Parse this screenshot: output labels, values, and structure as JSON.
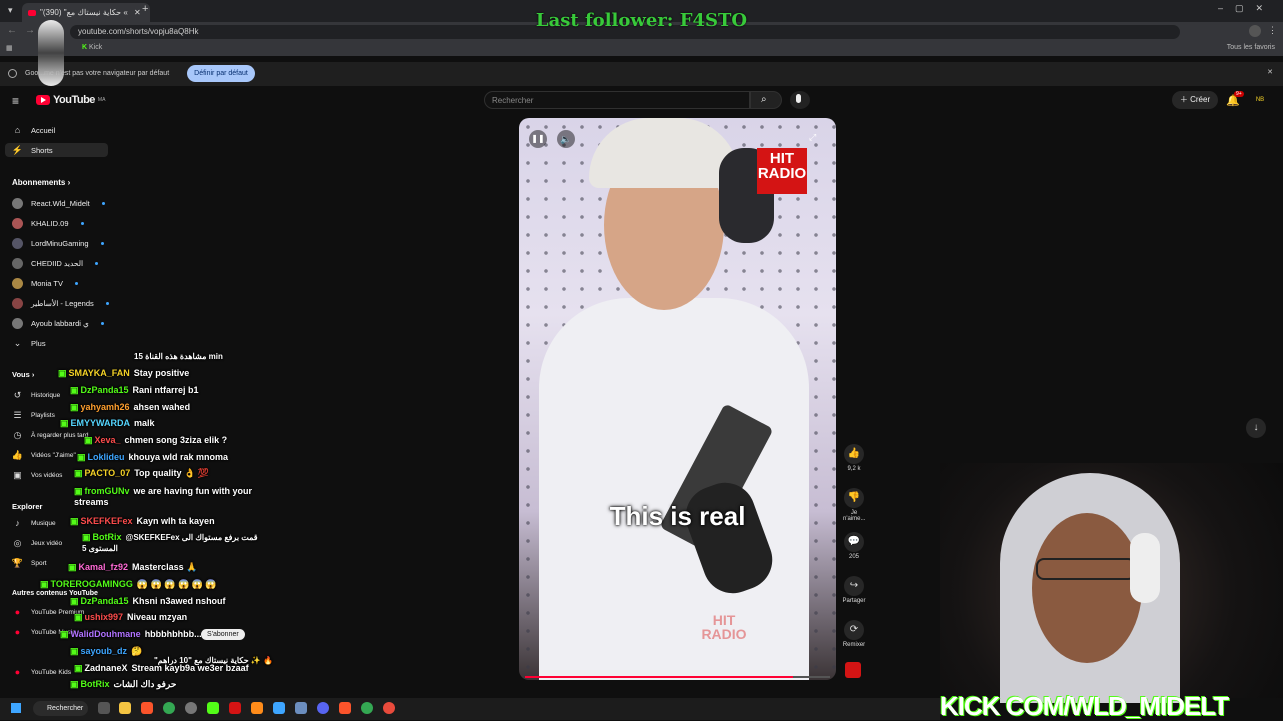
{
  "browser": {
    "tab_title": "\"حكاية نيستاك مع\" (390) «",
    "url": "youtube.com/shorts/vopju8aQ8Hk",
    "bookmarks": [
      "Kick"
    ],
    "bookmark_right": "Tous les favoris",
    "infobar_text": "Goo...me n'est pas votre navigateur par défaut",
    "infobar_button": "Définir par défaut"
  },
  "overlay": {
    "last_follower": "Last follower: F4STO"
  },
  "youtube": {
    "logo": "YouTube",
    "logo_sup": "MA",
    "search_placeholder": "Rechercher",
    "create_label": "Créer",
    "notification_badge": "9+",
    "avatar_initials": "NB"
  },
  "sidebar": {
    "main": [
      {
        "label": "Accueil",
        "icon": "home-icon"
      },
      {
        "label": "Shorts",
        "icon": "shorts-icon"
      }
    ],
    "subscriptions_title": "Abonnements",
    "subscriptions": [
      "React.Wld_Midelt",
      "KHALID.09",
      "LordMinuGaming",
      "CHEDIID الحديد",
      "Monia TV",
      "الأساطير - Legends",
      "Ayoub labbardi ي"
    ],
    "more_label": "Plus",
    "you_title": "Vous",
    "you_items": [
      "Historique",
      "Playlists",
      "À regarder plus tard",
      "Vidéos \"J'aime\"",
      "Vos vidéos"
    ],
    "explore_title": "Explorer",
    "explore_items": [
      "Musique",
      "Jeux vidéo",
      "Sport"
    ],
    "other_title": "Autres contenus YouTube",
    "other_items": [
      "YouTube Premium",
      "YouTube Music",
      "YouTube Kids"
    ]
  },
  "video": {
    "caption": "This is real",
    "hit_logo": "HIT RADIO",
    "watermark": "HIT RADIO",
    "progress": 0.88
  },
  "actions": {
    "likes": "9,2 k",
    "dislike": "Je n'aime...",
    "comments": "205",
    "share": "Partager",
    "remix": "Remixer"
  },
  "chat": [
    {
      "user": "",
      "text": "مشاهدة هذه القناة 15 min",
      "color": "#ffffff"
    },
    {
      "user": "SMAYKA_FAN",
      "text": "Stay positive",
      "color": "#f5d327"
    },
    {
      "user": "DzPanda15",
      "text": "Rani ntfarrej b1",
      "color": "#53fc18"
    },
    {
      "user": "yahyamh26",
      "text": "ahsen wahed",
      "color": "#ff9f2e"
    },
    {
      "user": "EMYYWARDA",
      "text": "malk",
      "color": "#56d6ff"
    },
    {
      "user": "Xeva_",
      "text": "chmen song 3ziza elik ?",
      "color": "#ff4d4d"
    },
    {
      "user": "Loklideu",
      "text": "khouya wld rak mnoma",
      "color": "#3ea6ff"
    },
    {
      "user": "PACTO_07",
      "text": "Top quality 👌 💯",
      "color": "#f5d327"
    },
    {
      "user": "fromGUNv",
      "text": "we are having fun with your streams",
      "color": "#53fc18"
    },
    {
      "user": "SKEFKEFex",
      "text": "Kayn wlh ta kayen",
      "color": "#ff4d4d"
    },
    {
      "user": "BotRix",
      "text": "@SKEFKEFex قمت برفع مستواك الى المستوى 5",
      "color": "#53fc18"
    },
    {
      "user": "Kamal_fz92",
      "text": "Masterclass 🙏",
      "color": "#ff6ad5"
    },
    {
      "user": "TOREROGAMINGG",
      "text": "😱 😱 😱 😱 😱 😱",
      "color": "#53fc18"
    },
    {
      "user": "DzPanda15",
      "text": "Khsni n3awed nshouf",
      "color": "#53fc18"
    },
    {
      "user": "ushix997",
      "text": "Niveau mzyan",
      "color": "#ff4d4d"
    },
    {
      "user": "WalidDouhmane",
      "text": "hbbbhbhbb...",
      "color": "#b072ff"
    },
    {
      "user": "sayoub_dz",
      "text": "🤔",
      "color": "#3ea6ff"
    },
    {
      "user": "",
      "text": "\"حكاية نيستاك مع \"10 دراهم ✨ 🔥",
      "color": "#ffffff"
    },
    {
      "user": "ZadnaneX",
      "text": "Stream kayb9a we3er bzaaf",
      "color": "#ffffff"
    },
    {
      "user": "BotRix",
      "text": "حرفو داك الشات",
      "color": "#53fc18"
    }
  ],
  "subscribe_chip": "S'abonner",
  "webcam": {
    "banner": "KICK COM/WLD_MIDELT"
  },
  "taskbar": {
    "search_label": "Rechercher"
  },
  "colors": {
    "kick_green": "#53fc18",
    "youtube_red": "#ff0033"
  }
}
